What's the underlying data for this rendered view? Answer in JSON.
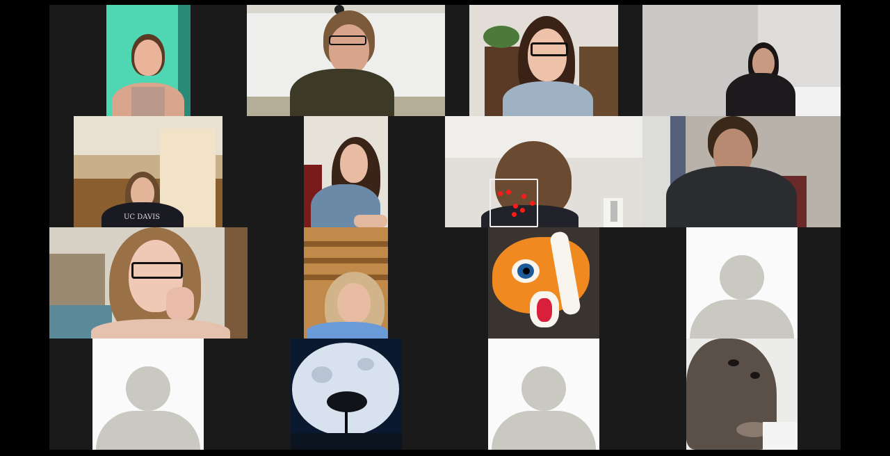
{
  "meeting": {
    "view": "gallery",
    "participant_count": 16
  },
  "rows": [
    {
      "tiles": [
        {
          "id": "p1",
          "type": "video",
          "scene": "teal-wall-girl"
        },
        {
          "id": "p2",
          "type": "video",
          "scene": "teacher-whiteboard",
          "whiteboard_text": ""
        },
        {
          "id": "p3",
          "type": "video",
          "scene": "girl-glasses-bookshelf"
        },
        {
          "id": "p4",
          "type": "video",
          "scene": "girl-dark-room"
        }
      ]
    },
    {
      "tiles": [
        {
          "id": "p5",
          "type": "video",
          "scene": "girl-hoodie-window",
          "shirt_text": "UC DAVIS"
        },
        {
          "id": "p6",
          "type": "video",
          "scene": "girl-leaning"
        },
        {
          "id": "p7",
          "type": "video",
          "scene": "top-of-head",
          "face_tracking": true
        },
        {
          "id": "p8",
          "type": "video",
          "scene": "boy-hoodie"
        }
      ]
    },
    {
      "tiles": [
        {
          "id": "p9",
          "type": "video",
          "scene": "girl-glasses-hand-chin"
        },
        {
          "id": "p10",
          "type": "video",
          "scene": "girl-ceiling-angle"
        },
        {
          "id": "p11",
          "type": "profile-image",
          "scene": "clownfish-plush"
        },
        {
          "id": "p12",
          "type": "avatar",
          "icon": "person-avatar-icon"
        }
      ]
    },
    {
      "tiles": [
        {
          "id": "p13",
          "type": "avatar",
          "icon": "person-avatar-icon"
        },
        {
          "id": "p14",
          "type": "profile-image",
          "scene": "full-moon-tree"
        },
        {
          "id": "p15",
          "type": "avatar",
          "icon": "person-avatar-icon"
        },
        {
          "id": "p16",
          "type": "profile-image",
          "scene": "seal"
        }
      ]
    }
  ],
  "colors": {
    "background": "#000000",
    "gallery_bg": "#1a1a1a",
    "avatar_bg": "#fafafa",
    "avatar_fg": "#c9c8c1",
    "tracker_dot": "#ff1a1a"
  }
}
